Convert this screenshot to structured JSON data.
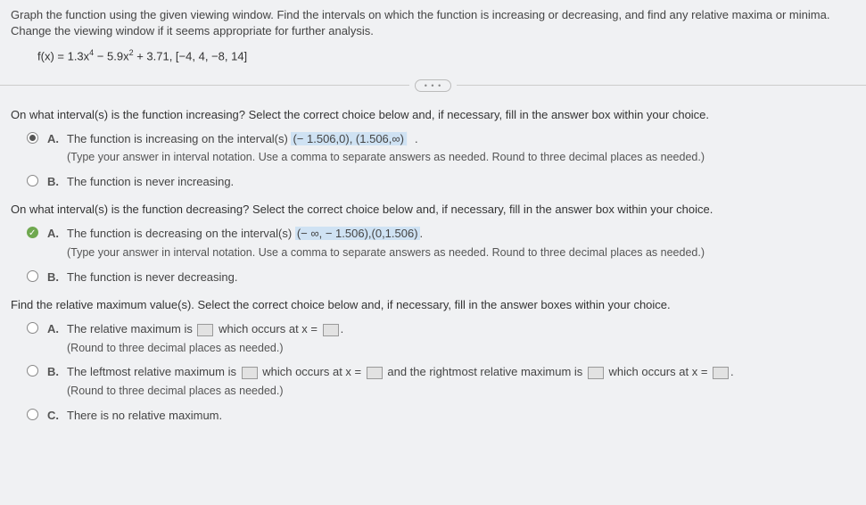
{
  "intro": "Graph the function using the given viewing window. Find the intervals on which the function is increasing or decreasing, and find any relative maxima or minima. Change the viewing window if it seems appropriate for further analysis.",
  "formula_plain": "f(x) = 1.3x⁴ − 5.9x² + 3.71, [−4, 4, −8, 14]",
  "q1": {
    "prompt": "On what interval(s) is the function increasing? Select the correct choice below and, if necessary, fill in the answer box within your choice.",
    "A_lead": "The function is increasing on the interval(s) ",
    "A_answer": "(− 1.506,0), (1.506,∞)",
    "A_tail": ".",
    "A_sub": "(Type your answer in interval notation. Use a comma to separate answers as needed. Round to three decimal places as needed.)",
    "B": "The function is never increasing."
  },
  "q2": {
    "prompt": "On what interval(s) is the function decreasing? Select the correct choice below and, if necessary, fill in the answer box within your choice.",
    "A_lead": "The function is decreasing on the interval(s) ",
    "A_answer": "(− ∞, − 1.506),(0,1.506)",
    "A_tail": ".",
    "A_sub": "(Type your answer in interval notation. Use a comma to separate answers as needed. Round to three decimal places as needed.)",
    "B": "The function is never decreasing."
  },
  "q3": {
    "prompt": "Find the relative maximum value(s). Select the correct choice below and, if necessary, fill in the answer boxes within your choice.",
    "A_lead": "The relative maximum is ",
    "A_mid": " which occurs at x = ",
    "A_tail": ".",
    "A_sub": "(Round to three decimal places as needed.)",
    "B_lead": "The leftmost relative maximum is ",
    "B_mid1": " which occurs at x = ",
    "B_mid2": " and the rightmost relative maximum is ",
    "B_mid3": " which occurs at x = ",
    "B_tail": ".",
    "B_sub": "(Round to three decimal places as needed.)",
    "C": "There is no relative maximum."
  },
  "labels": {
    "A": "A.",
    "B": "B.",
    "C": "C."
  },
  "dots": "• • •"
}
